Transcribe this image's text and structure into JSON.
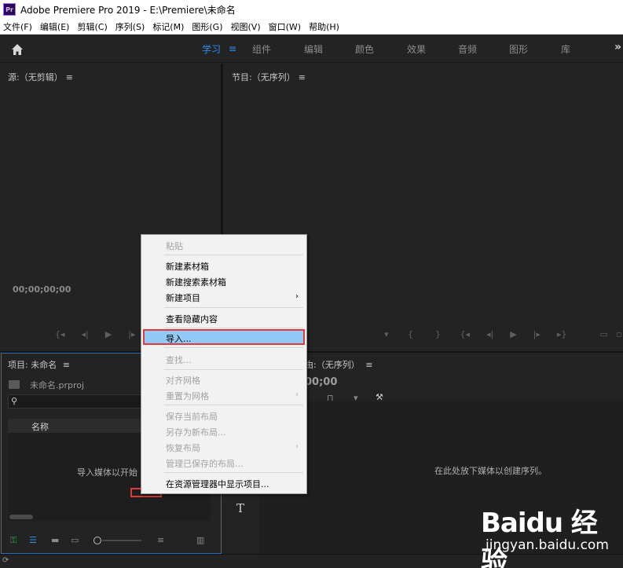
{
  "titlebar": {
    "app_icon_text": "Pr",
    "title": "Adobe Premiere Pro 2019 - E:\\Premiere\\未命名"
  },
  "menubar": {
    "items": [
      "文件(F)",
      "编辑(E)",
      "剪辑(C)",
      "序列(S)",
      "标记(M)",
      "图形(G)",
      "视图(V)",
      "窗口(W)",
      "帮助(H)"
    ]
  },
  "workspace": {
    "tabs": [
      "学习",
      "组件",
      "编辑",
      "颜色",
      "效果",
      "音频",
      "图形",
      "库"
    ],
    "active_tab": "学习",
    "more": "»"
  },
  "source_panel": {
    "title": "源:（无剪辑）",
    "timecode": "00;00;00;00"
  },
  "program_panel": {
    "title": "节目:（无序列）"
  },
  "project_panel": {
    "title": "项目: 未命名",
    "file_name": "未命名.prproj",
    "column_header": "名称",
    "empty_text": "导入媒体以开始"
  },
  "timeline_panel": {
    "title_partial": "由:（无序列）",
    "timecode_partial": "00;00",
    "drop_text": "在此处放下媒体以创建序列。"
  },
  "tools": {
    "type_tool": "T"
  },
  "context_menu": {
    "items": [
      {
        "label": "粘贴",
        "enabled": false,
        "submenu": false
      },
      {
        "label": "新建素材箱",
        "enabled": true,
        "submenu": false
      },
      {
        "label": "新建搜索素材箱",
        "enabled": true,
        "submenu": false
      },
      {
        "label": "新建项目",
        "enabled": true,
        "submenu": true
      },
      {
        "label": "查看隐藏内容",
        "enabled": true,
        "submenu": false
      },
      {
        "label": "导入...",
        "enabled": true,
        "submenu": false,
        "highlighted": true
      },
      {
        "label": "查找...",
        "enabled": false,
        "submenu": false
      },
      {
        "label": "对齐网格",
        "enabled": false,
        "submenu": false
      },
      {
        "label": "重置为网格",
        "enabled": false,
        "submenu": true
      },
      {
        "label": "保存当前布局",
        "enabled": false,
        "submenu": false
      },
      {
        "label": "另存为新布局...",
        "enabled": false,
        "submenu": false
      },
      {
        "label": "恢复布局",
        "enabled": false,
        "submenu": true
      },
      {
        "label": "管理已保存的布局...",
        "enabled": false,
        "submenu": false
      },
      {
        "label": "在资源管理器中显示项目...",
        "enabled": true,
        "submenu": false
      }
    ]
  },
  "watermark": {
    "logo": "Baidu 经验",
    "sub": "jingyan.baidu.com"
  },
  "colors": {
    "accent": "#2d8ceb",
    "highlight": "#91c9f7",
    "annotation_red": "#e0393e",
    "panel_bg": "#232323"
  }
}
